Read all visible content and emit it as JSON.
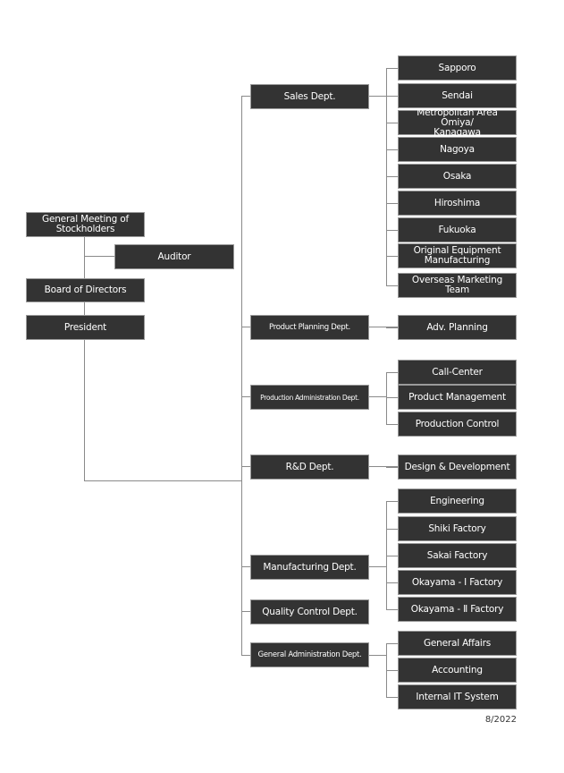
{
  "colors": {
    "box": "#333333",
    "box_border": "#9a9a9a",
    "line": "#8a8a8a"
  },
  "top": {
    "general_meeting": "General Meeting of Stockholders",
    "auditor": "Auditor",
    "board": "Board of Directors",
    "president": "President"
  },
  "departments": [
    {
      "name": "Sales Dept.",
      "units": [
        "Sapporo",
        "Sendai",
        "Metropolitan Area Omiya/ Kanagawa",
        "Nagoya",
        "Osaka",
        "Hiroshima",
        "Fukuoka",
        "Original Equipment Manufacturing",
        "Overseas Marketing Team"
      ]
    },
    {
      "name": "Product Planning Dept.",
      "units": [
        "Adv. Planning"
      ]
    },
    {
      "name": "Production Administration Dept.",
      "units": [
        "Call-Center",
        "Product Management",
        "Production Control"
      ]
    },
    {
      "name": "R&D Dept.",
      "units": [
        "Design & Development"
      ]
    },
    {
      "name": "Manufacturing Dept.",
      "units": [
        "Engineering",
        "Shiki Factory",
        "Sakai Factory",
        "Okayama - Ⅰ Factory",
        "Okayama - Ⅱ Factory"
      ]
    },
    {
      "name": "Quality Control Dept.",
      "units": []
    },
    {
      "name": "General Administration Dept.",
      "units": [
        "General Affairs",
        "Accounting",
        "Internal IT System"
      ]
    }
  ],
  "date": "8/2022"
}
